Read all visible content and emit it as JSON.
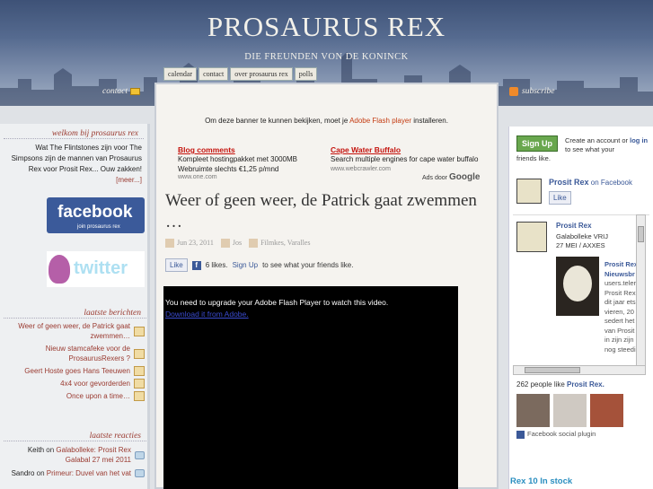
{
  "header": {
    "title": "PROSAURUS REX",
    "subtitle": "DIE FREUNDEN VON DE KONINCK",
    "tabs": [
      "calendar",
      "contact",
      "over prosaurus rex",
      "polls"
    ],
    "contact_label": "contact",
    "subscribe_label": "subscribe"
  },
  "left": {
    "welcome_title": "welkom bij prosaurus rex",
    "welcome_text": "Wat The Flintstones zijn voor The Simpsons zijn de mannen van Prosaurus Rex voor Prosit Rex... Ouw zakken!",
    "welcome_more": "[meer...]",
    "facebook_badge": "facebook",
    "facebook_sub": "join prosaurus rex",
    "twitter_badge": "twitter",
    "posts_title": "laatste berichten",
    "posts": [
      "Weer of geen weer, de Patrick gaat zwemmen…",
      "Nieuw stamcafeke voor de ProsaurusRexers ?",
      "Geert Hoste goes Hans Teeuwen",
      "4x4 voor gevorderden",
      "Once upon a time…"
    ],
    "reacties_title": "laatste reacties",
    "reacties": [
      {
        "author": "Keith",
        "sep": " on ",
        "post": "Galabolleke: Prosit Rex Galabal 27 mei 2011"
      },
      {
        "author": "Sandro",
        "sep": " on ",
        "post": "Primeur: Duvel van het vat"
      }
    ]
  },
  "center": {
    "banner_before": "Om deze banner te kunnen bekijken, moet je ",
    "banner_link": "Adobe Flash player",
    "banner_after": " installeren.",
    "ads": [
      {
        "title": "Blog comments",
        "line1": "Kompleet hostingpakket met 3000MB",
        "line2": "Webruimte slechts €1,25 p/mnd",
        "url": "www.one.com"
      },
      {
        "title": "Cape Water Buffalo",
        "line1": "Search multiple engines for cape water buffalo",
        "line2": "",
        "url": "www.webcrawler.com"
      }
    ],
    "ads_by": "Ads door",
    "ads_brand": "Google",
    "post_title": "Weer of geen weer, de Patrick gaat zwemmen …",
    "meta": {
      "date": "Jun 23, 2011",
      "author": "Jos",
      "category": "Filmkes, Varalles"
    },
    "like_button": "Like",
    "like_count_text": "6 likes.",
    "signup_link": "Sign Up",
    "like_tail": " to see what your friends like.",
    "video_message": "You need to upgrade your Adobe Flash Player to watch this video.",
    "video_link": "Download it from Adobe."
  },
  "right": {
    "signup_button": "Sign Up",
    "signup_text_a": "Create an account or ",
    "signup_login": "log in",
    "signup_text_b": " to see what your",
    "signup_tail": "friends like.",
    "page_name": "Prosit Rex",
    "page_on": " on Facebook",
    "like_button": "Like",
    "stream_name": "Prosit Rex",
    "stream_line1": "Galabolleke VRIJ",
    "stream_line2": "27 MEI / AXXES",
    "stream_side1": "Prosit Rex",
    "stream_side2": "Nieuwsbr",
    "stream_side3": "users.teler",
    "stream_side4": "Prosit Rex",
    "stream_side5": "dit jaar ets",
    "stream_side6": "vieren, 20",
    "stream_side7": "sedert het",
    "stream_side8": "van Prosit",
    "stream_side9": "in zijn zijn",
    "stream_side10": "nog steedi",
    "people_count": "262 people like ",
    "people_page": "Prosit Rex.",
    "plugin_label": "Facebook social plugin",
    "bottom_heading": "Rex 10 In stock"
  },
  "colors": {
    "header_top": "#3e5277",
    "accent_red": "#9a3a30",
    "facebook_blue": "#3b5998",
    "signup_green": "#69a74e"
  }
}
